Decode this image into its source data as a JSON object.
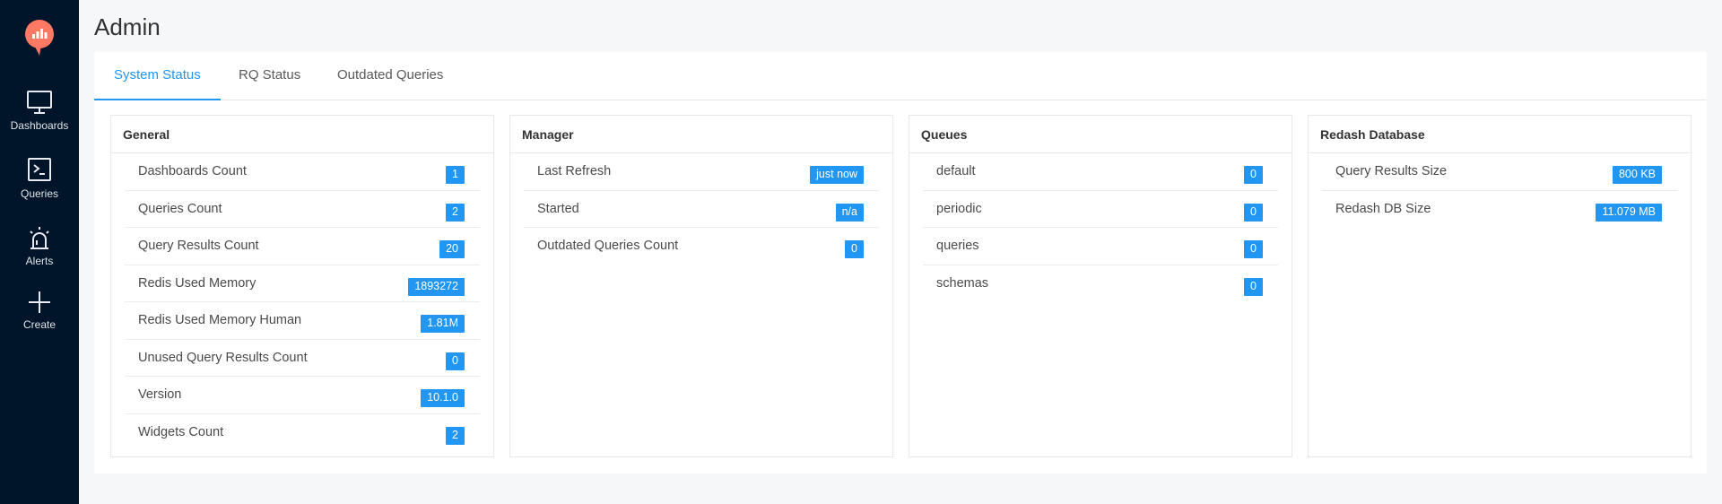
{
  "sidebar": {
    "items": [
      {
        "label": "Dashboards",
        "icon": "monitor-icon"
      },
      {
        "label": "Queries",
        "icon": "terminal-icon"
      },
      {
        "label": "Alerts",
        "icon": "siren-icon"
      },
      {
        "label": "Create",
        "icon": "plus-icon"
      }
    ]
  },
  "page": {
    "title": "Admin"
  },
  "tabs": [
    {
      "label": "System Status",
      "active": true
    },
    {
      "label": "RQ Status",
      "active": false
    },
    {
      "label": "Outdated Queries",
      "active": false
    }
  ],
  "panels": [
    {
      "title": "General",
      "rows": [
        {
          "label": "Dashboards Count",
          "value": "1"
        },
        {
          "label": "Queries Count",
          "value": "2"
        },
        {
          "label": "Query Results Count",
          "value": "20"
        },
        {
          "label": "Redis Used Memory",
          "value": "1893272"
        },
        {
          "label": "Redis Used Memory Human",
          "value": "1.81M"
        },
        {
          "label": "Unused Query Results Count",
          "value": "0"
        },
        {
          "label": "Version",
          "value": "10.1.0"
        },
        {
          "label": "Widgets Count",
          "value": "2"
        }
      ]
    },
    {
      "title": "Manager",
      "rows": [
        {
          "label": "Last Refresh",
          "value": "just now"
        },
        {
          "label": "Started",
          "value": "n/a"
        },
        {
          "label": "Outdated Queries Count",
          "value": "0"
        }
      ]
    },
    {
      "title": "Queues",
      "rows": [
        {
          "label": "default",
          "value": "0"
        },
        {
          "label": "periodic",
          "value": "0"
        },
        {
          "label": "queries",
          "value": "0"
        },
        {
          "label": "schemas",
          "value": "0"
        }
      ]
    },
    {
      "title": "Redash Database",
      "rows": [
        {
          "label": "Query Results Size",
          "value": "800 KB"
        },
        {
          "label": "Redash DB Size",
          "value": "11.079 MB"
        }
      ]
    }
  ],
  "colors": {
    "accent": "#2196f3",
    "sidebar": "#001529",
    "logo": "#ff7964"
  }
}
